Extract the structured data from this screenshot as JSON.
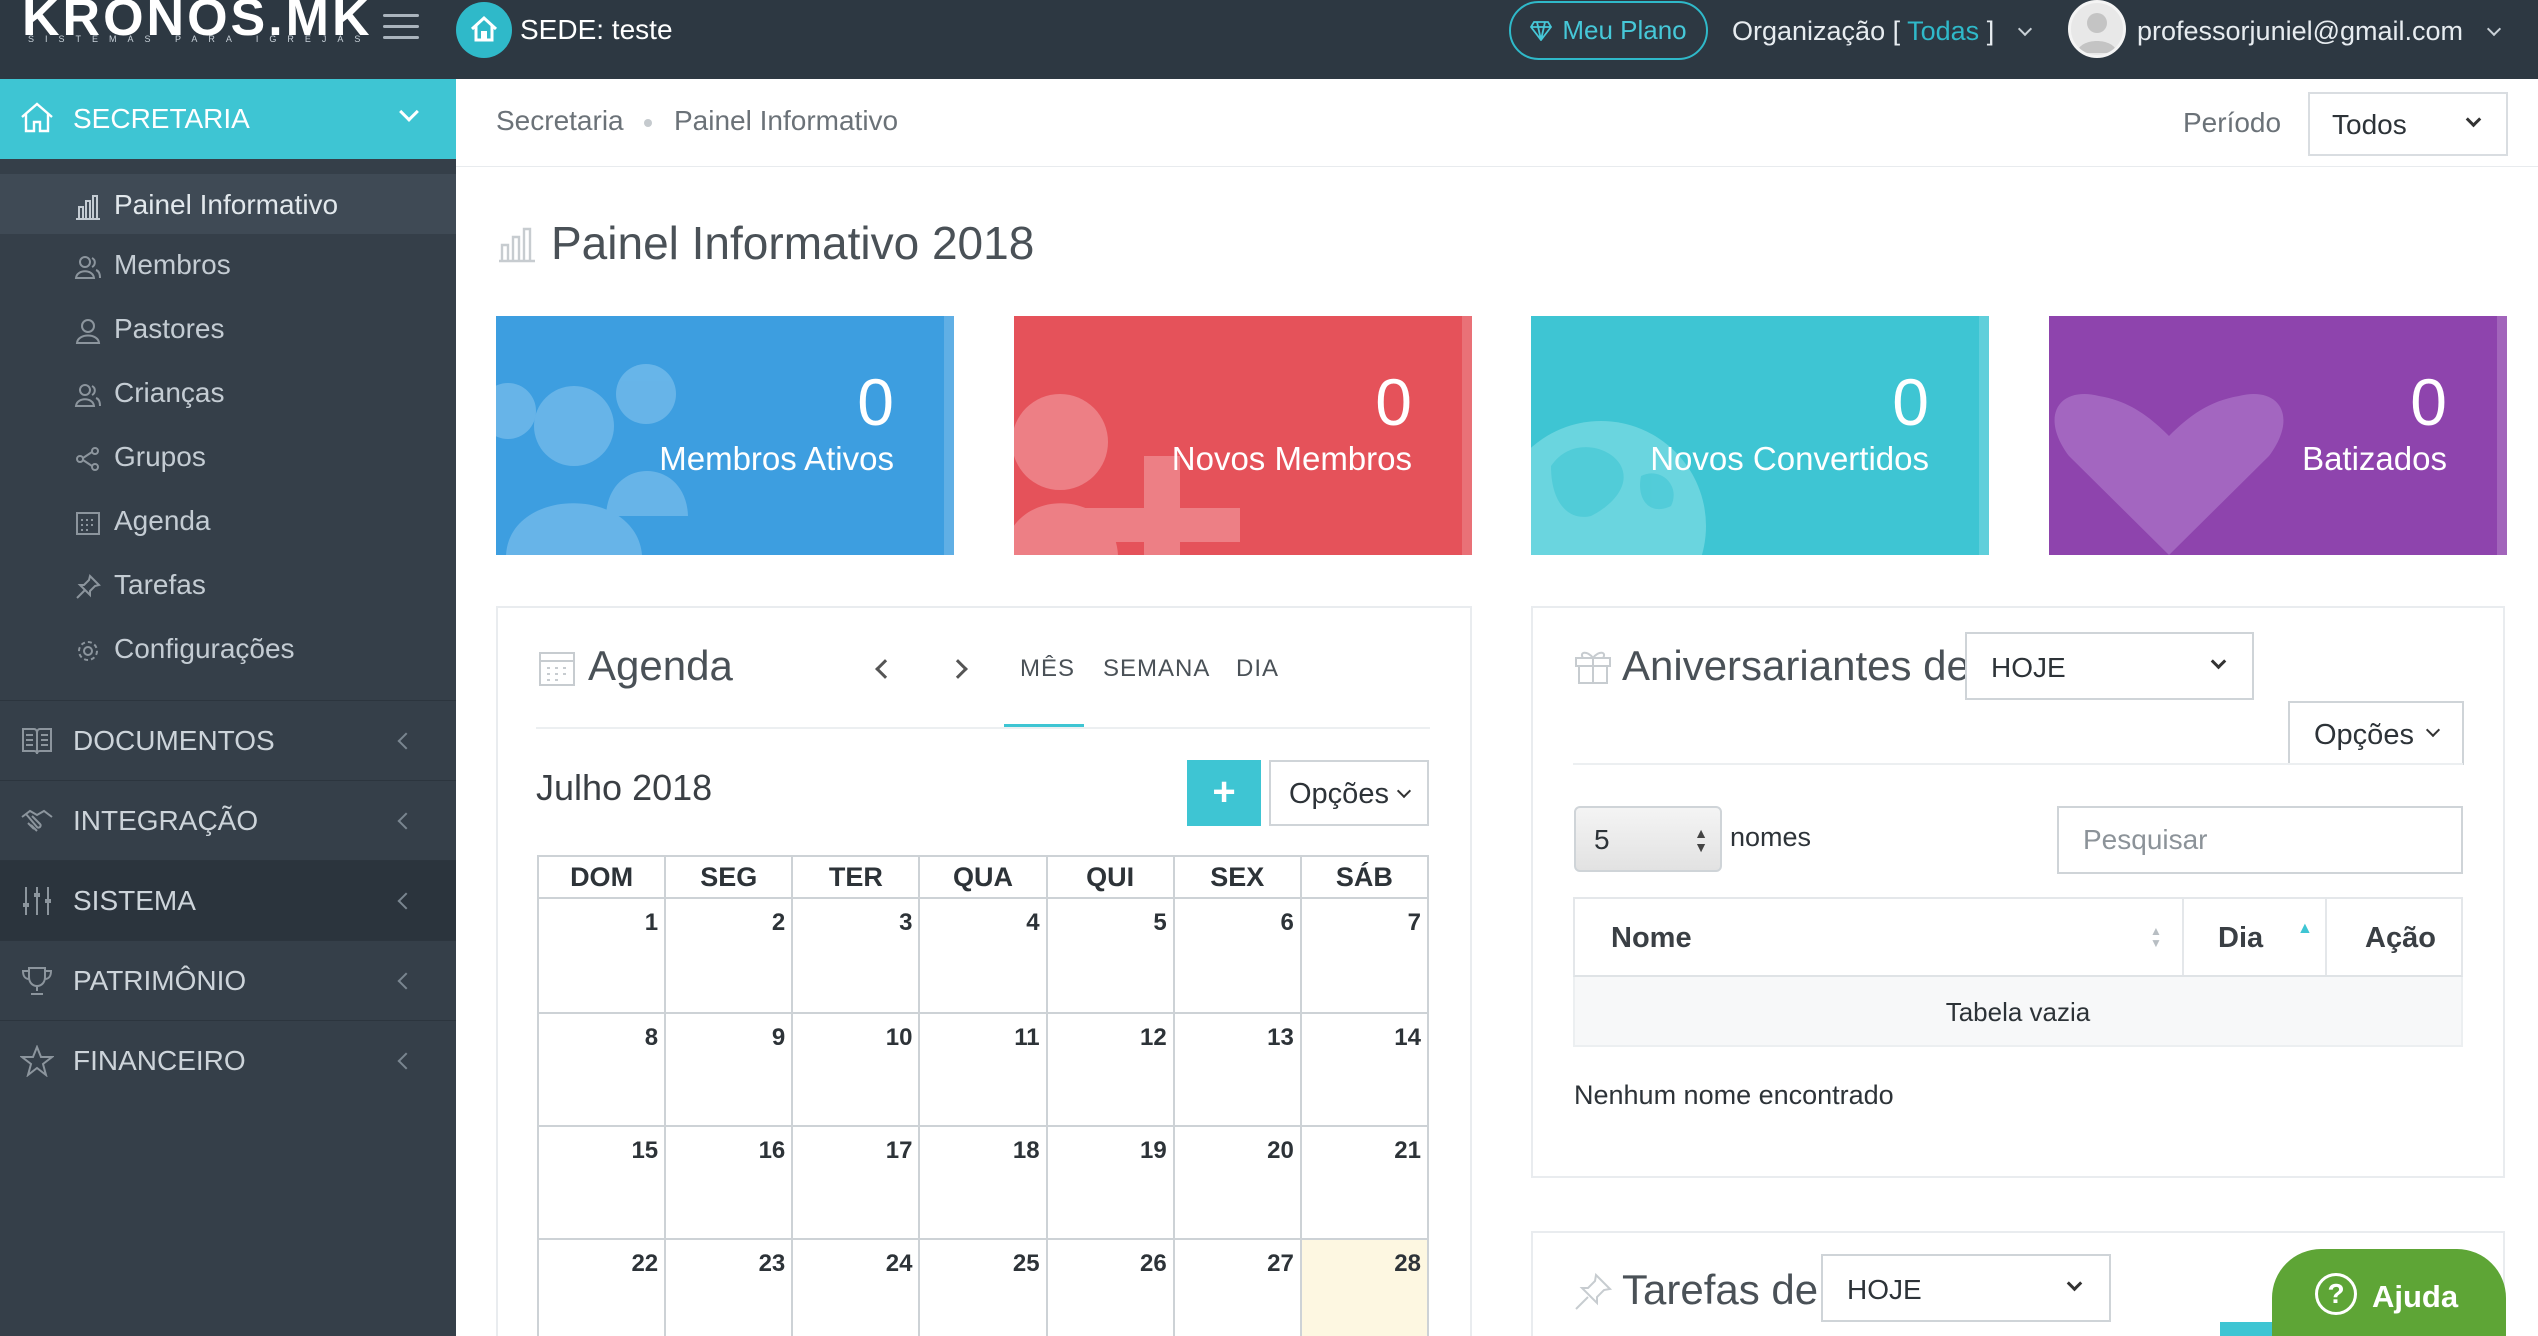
{
  "brand": {
    "logo_text": "KRONOS.MK",
    "logo_tagline": "SISTEMAS PARA IGREJAS"
  },
  "header": {
    "sede_label": "SEDE: teste",
    "plan_button": "Meu Plano",
    "org_prefix": "Organização [",
    "org_value": "Todas",
    "org_suffix": "]",
    "user_email": "professorjuniel@gmail.com"
  },
  "sidebar": {
    "section": "SECRETARIA",
    "sub_items": [
      {
        "label": "Painel Informativo",
        "icon": "bar-chart-icon",
        "active": true
      },
      {
        "label": "Membros",
        "icon": "users-icon"
      },
      {
        "label": "Pastores",
        "icon": "user-icon"
      },
      {
        "label": "Crianças",
        "icon": "children-icon"
      },
      {
        "label": "Grupos",
        "icon": "share-icon"
      },
      {
        "label": "Agenda",
        "icon": "calendar-icon"
      },
      {
        "label": "Tarefas",
        "icon": "pin-icon"
      },
      {
        "label": "Configurações",
        "icon": "gear-icon"
      }
    ],
    "menu": [
      {
        "label": "DOCUMENTOS",
        "icon": "book-icon"
      },
      {
        "label": "INTEGRAÇÃO",
        "icon": "handshake-icon"
      },
      {
        "label": "SISTEMA",
        "icon": "sliders-icon"
      },
      {
        "label": "PATRIMÔNIO",
        "icon": "trophy-icon"
      },
      {
        "label": "FINANCEIRO",
        "icon": "star-icon"
      }
    ]
  },
  "breadcrumb": [
    "Secretaria",
    "Painel Informativo"
  ],
  "period": {
    "label": "Período",
    "value": "Todos"
  },
  "page_title": "Painel Informativo 2018",
  "stats": [
    {
      "value": "0",
      "label": "Membros Ativos",
      "color": "#3d9ee0"
    },
    {
      "value": "0",
      "label": "Novos Membros",
      "color": "#e5525a"
    },
    {
      "value": "0",
      "label": "Novos Convertidos",
      "color": "#3ec5d3"
    },
    {
      "value": "0",
      "label": "Batizados",
      "color": "#8e44ad"
    }
  ],
  "agenda": {
    "title": "Agenda",
    "tabs": [
      "MÊS",
      "SEMANA",
      "DIA"
    ],
    "month": "Julho 2018",
    "add_label": "+",
    "options_label": "Opções",
    "weekdays": [
      "DOM",
      "SEG",
      "TER",
      "QUA",
      "QUI",
      "SEX",
      "SÁB"
    ],
    "weeks": [
      [
        "1",
        "2",
        "3",
        "4",
        "5",
        "6",
        "7"
      ],
      [
        "8",
        "9",
        "10",
        "11",
        "12",
        "13",
        "14"
      ],
      [
        "15",
        "16",
        "17",
        "18",
        "19",
        "20",
        "21"
      ],
      [
        "22",
        "23",
        "24",
        "25",
        "26",
        "27",
        "28"
      ]
    ],
    "today": "28"
  },
  "birthdays": {
    "title": "Aniversariantes de",
    "period": "HOJE",
    "options_label": "Opções",
    "page_length": "5",
    "length_label": "nomes",
    "search_placeholder": "Pesquisar",
    "columns": [
      "Nome",
      "Dia",
      "Ação"
    ],
    "empty_text": "Tabela vazia",
    "info_text": "Nenhum nome encontrado"
  },
  "tasks": {
    "title": "Tarefas de",
    "period": "HOJE"
  },
  "help": {
    "label": "Ajuda"
  },
  "colors": {
    "topbar": "#2d3842",
    "sidebar": "#353f49",
    "accent": "#3ec5d3",
    "help": "#5ea536"
  }
}
